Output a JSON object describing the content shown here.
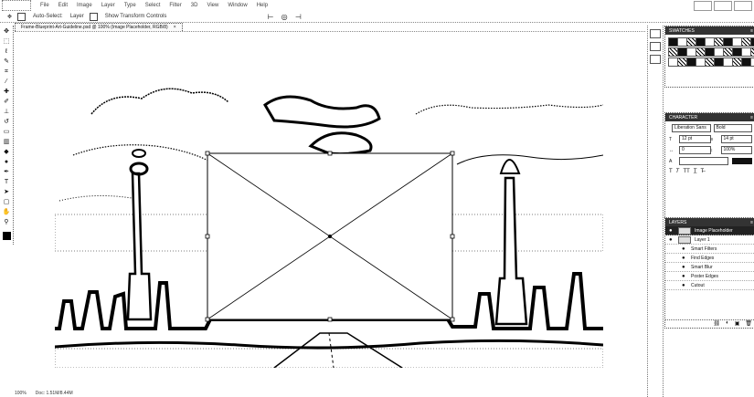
{
  "menubar": {
    "items": [
      "File",
      "Edit",
      "Image",
      "Layer",
      "Type",
      "Select",
      "Filter",
      "3D",
      "View",
      "Window",
      "Help"
    ]
  },
  "options": {
    "auto_select_label": "Auto-Select:",
    "auto_select_value": "Layer",
    "transform_label": "Show Transform Controls"
  },
  "document": {
    "tab_title": "Frame-Blueprint-Art-Guideline.psd @ 100% (Image Placeholder, RGB/8)",
    "close_glyph": "×"
  },
  "status": {
    "zoom": "100%",
    "doc_info": "Doc: 1.51M/8.44M"
  },
  "panels": {
    "swatches_tab": "SWATCHES",
    "character_tab": "CHARACTER",
    "font_family": "Liberation Sans",
    "font_style": "Bold",
    "font_size": "12 pt",
    "leading": "14 pt",
    "tracking": "0",
    "scale": "100%",
    "layers_tab": "LAYERS",
    "layers": [
      {
        "name": "Image Placeholder",
        "selected": true,
        "indent": false
      },
      {
        "name": "Layer 1",
        "selected": false,
        "indent": false
      },
      {
        "name": "Smart Filters",
        "selected": false,
        "indent": true
      },
      {
        "name": "Find Edges",
        "selected": false,
        "indent": true
      },
      {
        "name": "Smart Blur",
        "selected": false,
        "indent": true
      },
      {
        "name": "Poster Edges",
        "selected": false,
        "indent": true
      },
      {
        "name": "Cutout",
        "selected": false,
        "indent": true
      }
    ]
  },
  "icons": {
    "move": "move-tool-icon",
    "marquee": "marquee-tool-icon",
    "lasso": "lasso-tool-icon",
    "crop": "crop-tool-icon",
    "brush": "brush-tool-icon",
    "type": "type-tool-icon",
    "zoom": "zoom-tool-icon"
  }
}
